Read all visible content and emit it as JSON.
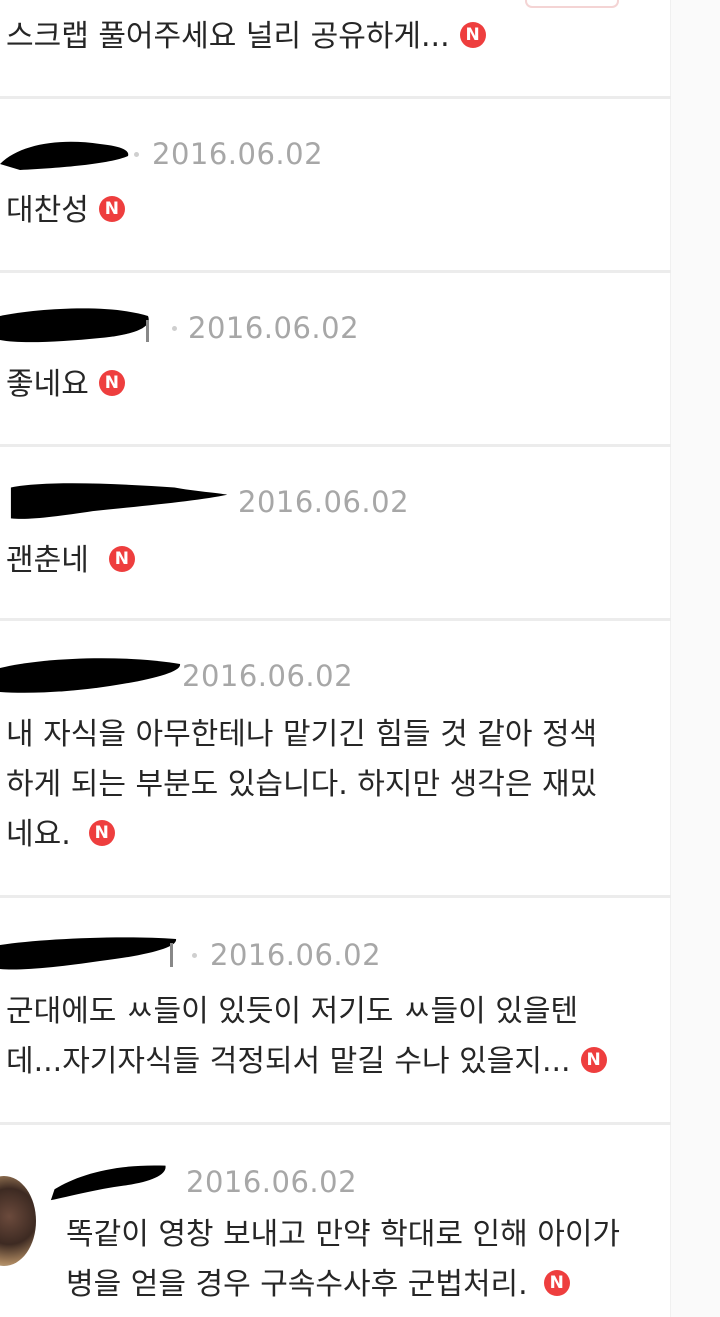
{
  "colors": {
    "background": "#ffffff",
    "separator": "#ececec",
    "date_text": "#a7a7a7",
    "body_text": "#262626",
    "new_badge": "#ee3e3e"
  },
  "new_badge_label": "N",
  "comments": [
    {
      "date": "",
      "lines": [
        "스크랩 풀어주세요 널리 공유하게..."
      ],
      "is_new": true
    },
    {
      "date": "2016.06.02",
      "lines": [
        "대찬성"
      ],
      "is_new": true
    },
    {
      "date": "2016.06.02",
      "lines": [
        "좋네요"
      ],
      "is_new": true
    },
    {
      "date": "2016.06.02",
      "lines": [
        "괜춘네"
      ],
      "is_new": true
    },
    {
      "date": "2016.06.02",
      "lines": [
        "내 자식을 아무한테나 맡기긴 힘들 것 같아 정색",
        "하게 되는 부분도 있습니다. 하지만 생각은 재밌",
        "네요."
      ],
      "is_new": true
    },
    {
      "date": "2016.06.02",
      "lines": [
        "군대에도 ㅆ들이 있듯이 저기도 ㅆ들이 있을텐",
        "데...자기자식들 걱정되서 맡길 수나 있을지..."
      ],
      "is_new": true
    },
    {
      "date": "2016.06.02",
      "lines": [
        "똑같이 영창 보내고 만약 학대로 인해 아이가",
        "병을 얻을 경우 구속수사후 군법처리."
      ],
      "is_new": true
    }
  ]
}
